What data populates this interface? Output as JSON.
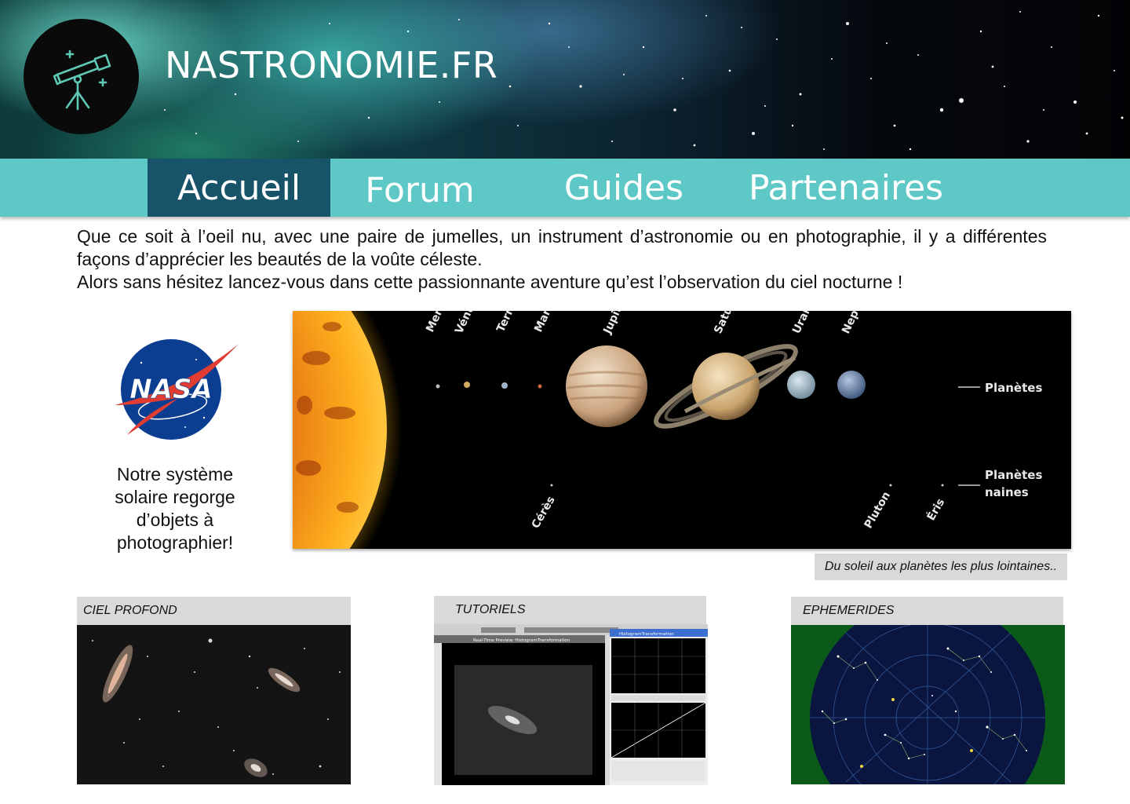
{
  "header": {
    "site_title": "NASTRONOMIE.FR",
    "logo_icon": "telescope-icon"
  },
  "nav": {
    "items": [
      {
        "label": "Accueil",
        "active": true
      },
      {
        "label": "Forum",
        "active": false
      },
      {
        "label": "Guides",
        "active": false
      },
      {
        "label": "Partenaires",
        "active": false
      }
    ],
    "active_color": "#17546a",
    "bar_color": "#5ec8c6"
  },
  "intro": {
    "paragraph1": "Que ce soit à l’oeil nu, avec une paire de jumelles, un instrument d’astronomie ou en photographie, il y a différentes façons d’apprécier les beautés de la voûte céleste.",
    "paragraph2": "Alors sans hésitez lancez-vous dans cette passionnante aventure qu’est l’observation du ciel nocturne !"
  },
  "sidebar": {
    "logo_text": "NASA",
    "caption": "Notre système solaire regorge d’objets à photographier!"
  },
  "solar_image": {
    "planet_labels": [
      "Mercure",
      "Vénus",
      "Terre",
      "Mars",
      "Jupiter",
      "Saturne",
      "Uranus",
      "Neptune"
    ],
    "dwarf_labels": [
      "Cérès",
      "Pluton",
      "Éris"
    ],
    "legend_planets": "Planètes",
    "legend_dwarf_line1": "Planètes",
    "legend_dwarf_line2": "naines",
    "caption": "Du soleil aux planètes les plus lointaines.."
  },
  "cards": [
    {
      "label": "CIEL PROFOND",
      "image": "deep-sky-galaxies"
    },
    {
      "label": "TUTORIELS",
      "image": "software-screenshot"
    },
    {
      "label": "EPHEMERIDES",
      "image": "star-chart"
    }
  ],
  "tutorial_window": {
    "preview_title": "Real-Time Preview: HistogramTransformation",
    "panel_title": "HistogramTransformation"
  }
}
